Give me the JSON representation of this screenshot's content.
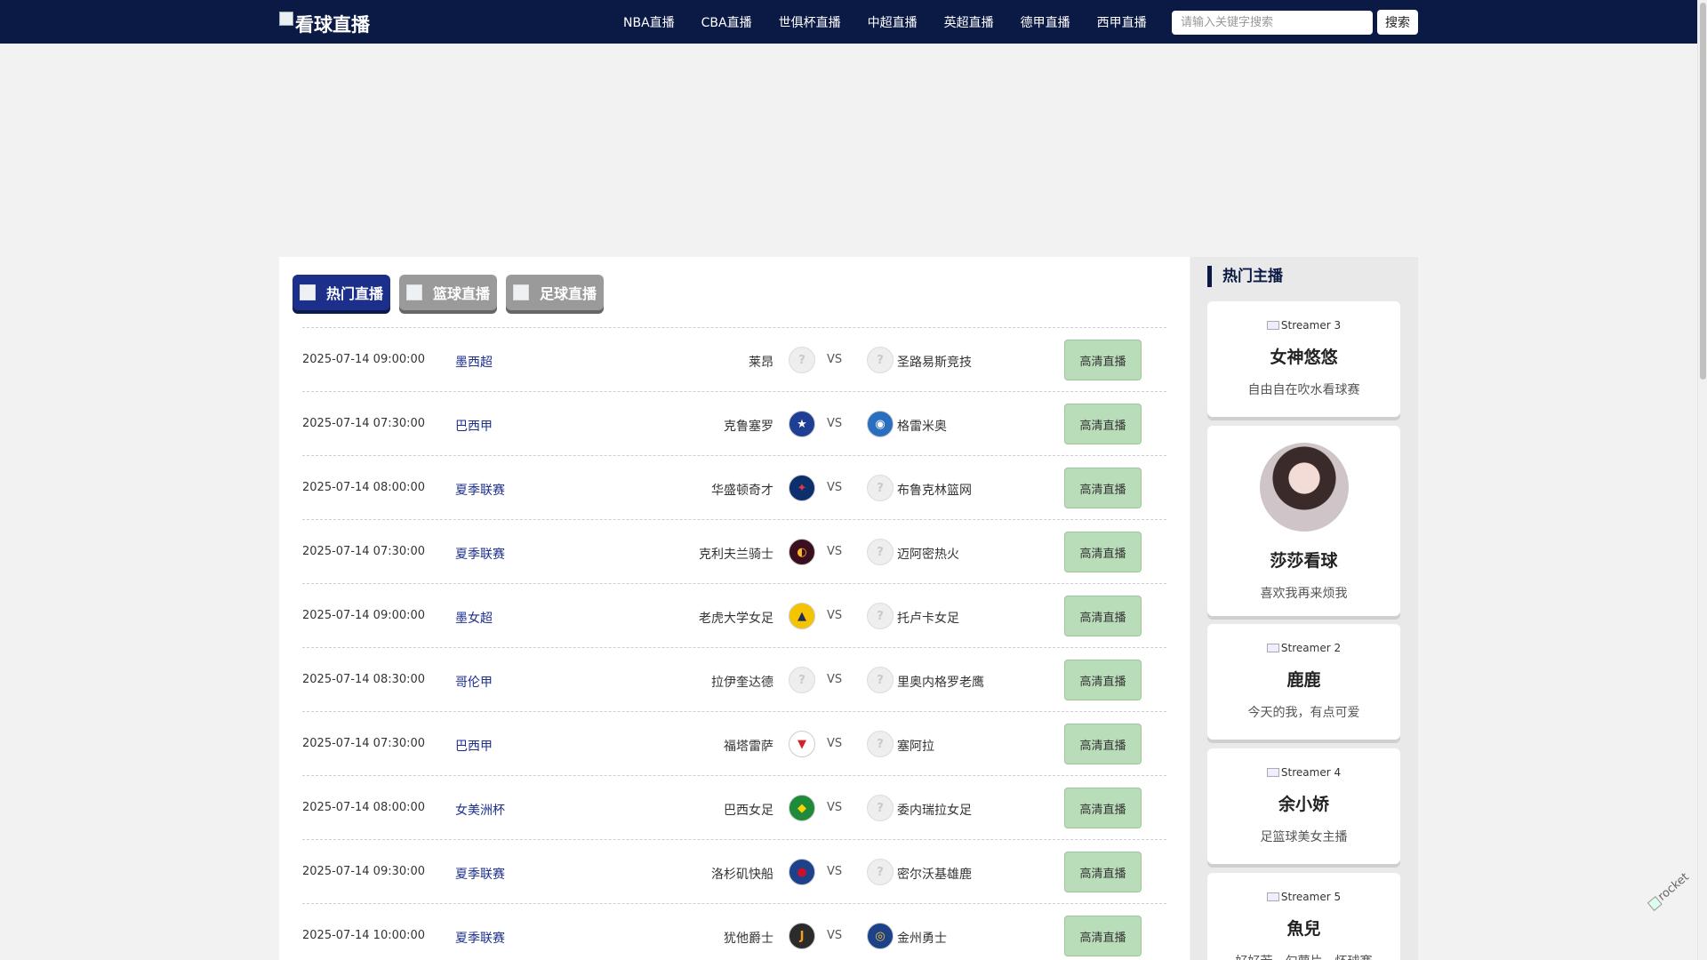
{
  "header": {
    "logo_text": "看球直播",
    "nav": [
      "NBA直播",
      "CBA直播",
      "世俱杯直播",
      "中超直播",
      "英超直播",
      "德甲直播",
      "西甲直播"
    ],
    "search_placeholder": "请输入关键字搜索",
    "search_button": "搜索"
  },
  "tabs": [
    "热门直播",
    "篮球直播",
    "足球直播"
  ],
  "live_button_label": "高清直播",
  "vs_label": "VS",
  "matches": [
    {
      "time": "2025-07-14 09:00:00",
      "league": "墨西超",
      "home": "莱昂",
      "away": "圣路易斯竞技",
      "home_logo": "unknown",
      "away_logo": "unknown"
    },
    {
      "time": "2025-07-14 07:30:00",
      "league": "巴西甲",
      "home": "克鲁塞罗",
      "away": "格雷米奥",
      "home_logo": "cruzeiro",
      "away_logo": "gremio"
    },
    {
      "time": "2025-07-14 08:00:00",
      "league": "夏季联赛",
      "home": "华盛顿奇才",
      "away": "布鲁克林篮网",
      "home_logo": "wizards",
      "away_logo": "unknown"
    },
    {
      "time": "2025-07-14 07:30:00",
      "league": "夏季联赛",
      "home": "克利夫兰骑士",
      "away": "迈阿密热火",
      "home_logo": "cavaliers",
      "away_logo": "unknown"
    },
    {
      "time": "2025-07-14 09:00:00",
      "league": "墨女超",
      "home": "老虎大学女足",
      "away": "托卢卡女足",
      "home_logo": "tigres",
      "away_logo": "unknown"
    },
    {
      "time": "2025-07-14 08:30:00",
      "league": "哥伦甲",
      "home": "拉伊奎达德",
      "away": "里奥内格罗老鹰",
      "home_logo": "unknown",
      "away_logo": "unknown"
    },
    {
      "time": "2025-07-14 07:30:00",
      "league": "巴西甲",
      "home": "福塔雷萨",
      "away": "塞阿拉",
      "home_logo": "fortaleza",
      "away_logo": "unknown"
    },
    {
      "time": "2025-07-14 08:00:00",
      "league": "女美洲杯",
      "home": "巴西女足",
      "away": "委内瑞拉女足",
      "home_logo": "brazil",
      "away_logo": "unknown"
    },
    {
      "time": "2025-07-14 09:30:00",
      "league": "夏季联赛",
      "home": "洛杉矶快船",
      "away": "密尔沃基雄鹿",
      "home_logo": "clippers",
      "away_logo": "unknown"
    },
    {
      "time": "2025-07-14 10:00:00",
      "league": "夏季联赛",
      "home": "犹他爵士",
      "away": "金州勇士",
      "home_logo": "jazz",
      "away_logo": "warriors"
    }
  ],
  "sidebar": {
    "title": "热门主播",
    "streamers": [
      {
        "alt": "Streamer 3",
        "name": "女神悠悠",
        "desc": "自由自在吹水看球赛"
      },
      {
        "alt": "",
        "name": "莎莎看球",
        "desc": "喜欢我再来烦我"
      },
      {
        "alt": "Streamer 2",
        "name": "鹿鹿",
        "desc": "今天的我，有点可爱"
      },
      {
        "alt": "Streamer 4",
        "name": "余小娇",
        "desc": "足篮球美女主播"
      },
      {
        "alt": "Streamer 5",
        "name": "魚兒",
        "desc": "好好若，勾萝片，怀球赛"
      }
    ]
  },
  "rocket_alt": "rocket",
  "colors": {
    "navy": "#0b1a45",
    "tab_active": "#1c2f8b",
    "live_button": "#b9dcb9"
  }
}
